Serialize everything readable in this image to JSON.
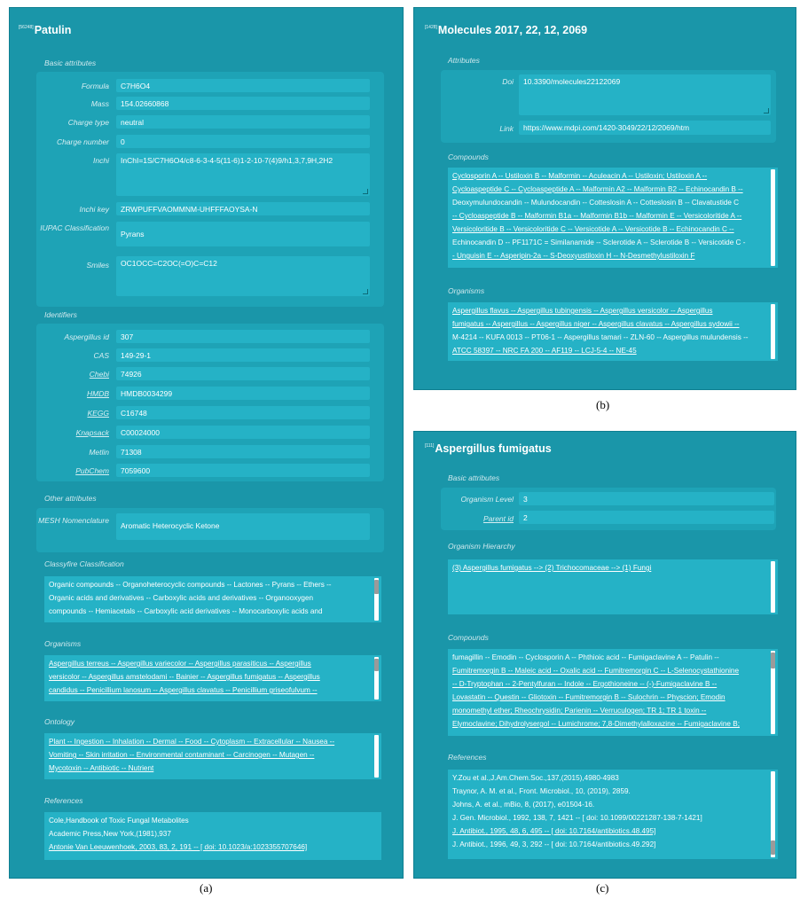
{
  "panel_a": {
    "title_tag": "[56248]",
    "title": "Patulin",
    "basic_label": "Basic attributes",
    "basic_rows": [
      {
        "label": "Formula",
        "value": "C7H6O4"
      },
      {
        "label": "Mass",
        "value": "154.02660868"
      },
      {
        "label": "Charge type",
        "value": "neutral"
      },
      {
        "label": "Charge number",
        "value": "0"
      },
      {
        "label": "Inchi",
        "value": "InChI=1S/C7H6O4/c8-6-3-4-5(11-6)1-2-10-7(4)9/h1,3,7,9H,2H2"
      },
      {
        "label": "Inchi key",
        "value": "ZRWPUFFVAOMMNM-UHFFFAOYSA-N"
      },
      {
        "label": "IUPAC Classification",
        "value": "Pyrans"
      },
      {
        "label": "Smiles",
        "value": "OC1OCC=C2OC(=O)C=C12"
      }
    ],
    "identifiers_label": "Identifiers",
    "identifier_rows": [
      {
        "label": "Aspergillus id",
        "value": "307"
      },
      {
        "label": "CAS",
        "value": "149-29-1"
      },
      {
        "label": "Chebi",
        "value": "74926"
      },
      {
        "label": "HMDB",
        "value": "HMDB0034299"
      },
      {
        "label": "KEGG",
        "value": "C16748"
      },
      {
        "label": "Knapsack",
        "value": "C00024000"
      },
      {
        "label": "Metlin",
        "value": "71308"
      },
      {
        "label": "PubChem",
        "value": "7059600"
      }
    ],
    "other_label": "Other attributes",
    "mesh_label": "MESH Nomenclature",
    "mesh_value": "Aromatic Heterocyclic Ketone",
    "classyfire_label": "Classyfire Classification",
    "classyfire_lines": [
      "Organic compounds -- Organoheterocyclic compounds -- Lactones -- Pyrans -- Ethers --",
      "Organic acids and derivatives -- Carboxylic acids and derivatives -- Organooxygen",
      "compounds -- Hemiacetals -- Carboxylic acid derivatives -- Monocarboxylic acids and"
    ],
    "organisms_label": "Organisms",
    "organisms_lines": [
      "Aspergillus terreus -- Aspergillus variecolor -- Aspergillus parasiticus -- Aspergillus",
      "versicolor -- Aspergillus amstelodami -- Bainier -- Aspergillus fumigatus -- Aspergillus",
      "candidus -- Penicillium lanosum -- Aspergillus clavatus -- Penicillium griseofulvum --"
    ],
    "ontology_label": "Ontology",
    "ontology_lines": [
      "Plant -- Ingestion -- Inhalation -- Dermal -- Food -- Cytoplasm -- Extracellular -- Nausea --",
      "Vomiting -- Skin irritation -- Environmental contaminant -- Carcinogen -- Mutagen --",
      "Mycotoxin -- Antibiotic -- Nutrient"
    ],
    "references_label": "References",
    "references_lines": [
      "Cole,Handbook of Toxic Fungal Metabolites",
      "Academic Press,New York,(1981),937",
      "Antonie Van Leeuwenhoek, 2003, 83, 2, 191 -- [ doi: 10.1023/a:1023355707646]"
    ]
  },
  "panel_b": {
    "title_tag": "[1428]",
    "title": "Molecules 2017, 22, 12, 2069",
    "attributes_label": "Attributes",
    "doi_label": "Doi",
    "doi_value": "10.3390/molecules22122069",
    "link_label": "Link",
    "link_value": "https://www.mdpi.com/1420-3049/22/12/2069/htm",
    "compounds_label": "Compounds",
    "compounds_lines": [
      "Cyclosporin A -- Ustiloxin B -- Malformin -- Aculeacin A -- Ustiloxin; Ustiloxin A --",
      "Cycloaspeptide C -- Cycloaspeptide A -- Malformin A2 -- Malformin B2 -- Echinocandin B --",
      "Deoxymulundocandin -- Mulundocandin -- Cotteslosin A -- Cotteslosin B -- Clavatustide C",
      "-- Cycloaspeptide B -- Malformin B1a -- Malformin B1b -- Malformin E -- Versicoloritide A --",
      "Versicoloritide B -- Versicoloritide C -- Versicotide A -- Versicotide B -- Echinocandin C --",
      "Echinocandin D -- PF1171C = Similanamide -- Sclerotide A -- Sclerotide B -- Versicotide C -",
      "- Unguisin E -- Asperipin-2a -- S-Deoxyustiloxin H -- N-Desmethylustiloxin F"
    ],
    "organisms_label": "Organisms",
    "organisms_lines": [
      "Aspergillus flavus -- Aspergillus tubingensis -- Aspergillus versicolor -- Aspergillus",
      "fumigatus -- Aspergillus -- Aspergillus niger -- Aspergillus clavatus -- Aspergillus sydowii --",
      "M-4214 -- KUFA 0013 -- PT06-1 -- Aspergillus tamari -- ZLN-60 -- Aspergillus mulundensis --",
      "ATCC 58397 -- NRC FA 200 -- AF119 -- LCJ-5-4 -- NE-45"
    ]
  },
  "panel_c": {
    "title_tag": "[111]",
    "title": "Aspergillus fumigatus",
    "basic_label": "Basic attributes",
    "level_label": "Organism Level",
    "level_value": "3",
    "parent_label": "Parent id",
    "parent_value": "2",
    "hierarchy_label": "Organism Hierarchy",
    "hierarchy_line": "(3) Aspergillus fumigatus --> (2) Trichocomaceae --> (1) Fungi",
    "compounds_label": "Compounds",
    "compounds_lines": [
      "fumagillin -- Emodin -- Cyclosporin A -- Phthioic acid -- Fumigaclavine A -- Patulin --",
      "Fumitremorgin B -- Maleic acid -- Oxalic acid -- Fumitremorgin C -- L-Selenocystathionine",
      "-- D-Tryptophan -- 2-Pentylfuran -- Indole -- Ergothioneine -- (-)-Fumigaclavine B --",
      "Lovastatin -- Questin -- Gliotoxin -- Fumitremorgin B -- Sulochrin -- Physcion; Emodin",
      "monomethyl ether; Rheochrysidin; Parienin -- Verruculogen; TR 1; TR 1 toxin --",
      "Elymoclavine; Dihydrolysergol -- Lumichrome; 7,8-Dimethylalloxazine -- Fumigaclavine B;"
    ],
    "references_label": "References",
    "references_lines": [
      "Y.Zou et al.,J.Am.Chem.Soc.,137,(2015),4980-4983",
      "Traynor, A. M. et al., Front. Microbiol., 10, (2019), 2859.",
      "Johns, A. et al., mBio, 8, (2017), e01504-16.",
      "J. Gen. Microbiol., 1992, 138, 7, 1421 -- [ doi: 10.1099/00221287-138-7-1421]",
      "J. Antibiot., 1995, 48, 6, 495 -- [ doi: 10.7164/antibiotics.48.495]",
      "J. Antibiot., 1996, 49, 3, 292 -- [ doi: 10.7164/antibiotics.49.292]"
    ]
  },
  "captions": {
    "a": "(a)",
    "b": "(b)",
    "c": "(c)"
  }
}
